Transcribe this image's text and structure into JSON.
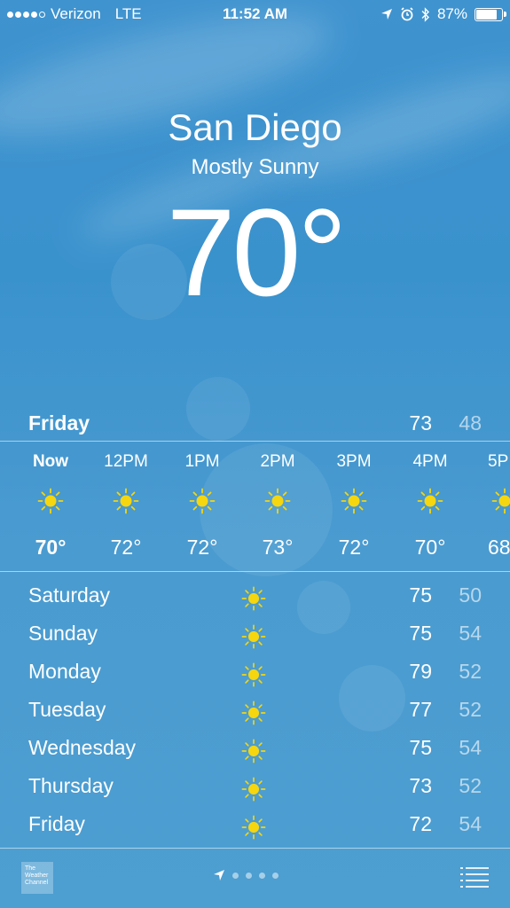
{
  "status": {
    "carrier": "Verizon",
    "network": "LTE",
    "time": "11:52 AM",
    "battery": "87%",
    "battery_level": 0.87,
    "icons": [
      "location-arrow-icon",
      "alarm-icon",
      "bluetooth-icon",
      "battery-icon"
    ]
  },
  "location": {
    "city": "San Diego",
    "condition": "Mostly Sunny",
    "temperature": "70°"
  },
  "today": {
    "day": "Friday",
    "high": "73",
    "low": "48"
  },
  "hourly": [
    {
      "time": "Now",
      "icon": "sun-icon",
      "temp": "70°"
    },
    {
      "time": "12PM",
      "icon": "sun-icon",
      "temp": "72°"
    },
    {
      "time": "1PM",
      "icon": "sun-icon",
      "temp": "72°"
    },
    {
      "time": "2PM",
      "icon": "sun-icon",
      "temp": "73°"
    },
    {
      "time": "3PM",
      "icon": "sun-icon",
      "temp": "72°"
    },
    {
      "time": "4PM",
      "icon": "sun-icon",
      "temp": "70°"
    },
    {
      "time": "5P",
      "icon": "sun-icon",
      "temp": "68"
    }
  ],
  "daily": [
    {
      "day": "Saturday",
      "icon": "sun-icon",
      "high": "75",
      "low": "50"
    },
    {
      "day": "Sunday",
      "icon": "sun-icon",
      "high": "75",
      "low": "54"
    },
    {
      "day": "Monday",
      "icon": "sun-icon",
      "high": "79",
      "low": "52"
    },
    {
      "day": "Tuesday",
      "icon": "sun-icon",
      "high": "77",
      "low": "52"
    },
    {
      "day": "Wednesday",
      "icon": "sun-icon",
      "high": "75",
      "low": "54"
    },
    {
      "day": "Thursday",
      "icon": "sun-icon",
      "high": "73",
      "low": "52"
    },
    {
      "day": "Friday",
      "icon": "sun-icon",
      "high": "72",
      "low": "54"
    }
  ],
  "footer": {
    "logo_text": "The Weather Channel",
    "page_count": 4
  },
  "colors": {
    "sun": "#f5d60f",
    "background": "#3f93cf"
  }
}
